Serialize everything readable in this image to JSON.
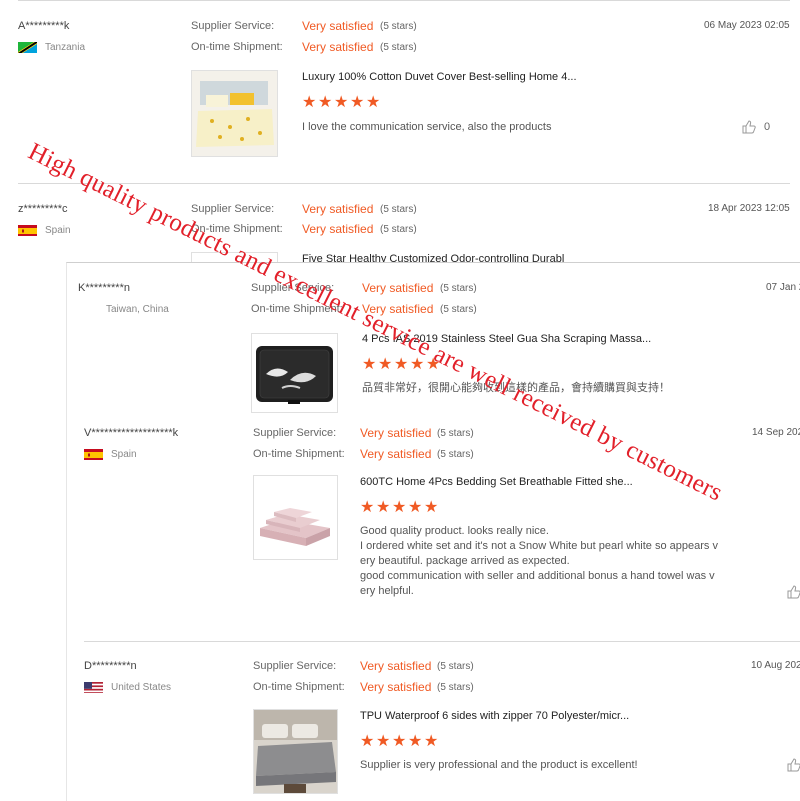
{
  "reviews_back": [
    {
      "name": "A*********k",
      "country": "Tanzania",
      "supplier_label": "Supplier Service:",
      "supplier_value": "Very satisfied",
      "supplier_stars": "(5 stars)",
      "shipment_label": "On-time Shipment:",
      "shipment_value": "Very satisfied",
      "shipment_stars": "(5 stars)",
      "date": "06 May 2023 02:05",
      "product_title": "Luxury 100% Cotton Duvet Cover Best-selling Home 4...",
      "comment": "I love the communication service, also the products",
      "likes": "0"
    },
    {
      "name": "z*********c",
      "country": "Spain",
      "supplier_label": "Supplier Service:",
      "supplier_value": "Very satisfied",
      "supplier_stars": "(5 stars)",
      "shipment_label": "On-time Shipment:",
      "shipment_value": "Very satisfied",
      "shipment_stars": "(5 stars)",
      "date": "18 Apr 2023 12:05",
      "product_title": "Five Star Healthy Customized Odor-controlling Durabl"
    }
  ],
  "reviews_front": [
    {
      "name": "K*********n",
      "country": "Taiwan, China",
      "supplier_label": "Supplier Service:",
      "supplier_value": "Very satisfied",
      "supplier_stars": "(5 stars)",
      "shipment_label": "On-time Shipment:",
      "shipment_value": "Very satisfied",
      "shipment_stars": "(5 stars)",
      "date": "07 Jan 2",
      "product_title": "4 Pcs IAS 2019 Stainless Steel Gua Sha Scraping Massa...",
      "comment_lines": [
        "品質非常好，很開心能夠收到這樣的產品，會持續購買與支持！"
      ]
    },
    {
      "name": "V*******************k",
      "country": "Spain",
      "supplier_label": "Supplier Service:",
      "supplier_value": "Very satisfied",
      "supplier_stars": "(5 stars)",
      "shipment_label": "On-time Shipment:",
      "shipment_value": "Very satisfied",
      "shipment_stars": "(5 stars)",
      "date": "14 Sep 202",
      "product_title": "600TC Home 4Pcs Bedding Set Breathable Fitted she...",
      "comment_lines": [
        "Good quality product. looks really nice.",
        "I ordered white set and it's not a Snow White but pearl white so appears v",
        "ery beautiful. package arrived as expected.",
        "good communication with seller and additional bonus a hand towel was v",
        "ery helpful."
      ]
    },
    {
      "name": "D*********n",
      "country": "United States",
      "supplier_label": "Supplier Service:",
      "supplier_value": "Very satisfied",
      "supplier_stars": "(5 stars)",
      "shipment_label": "On-time Shipment:",
      "shipment_value": "Very satisfied",
      "shipment_stars": "(5 stars)",
      "date": "10 Aug 202",
      "product_title": "TPU Waterproof 6 sides with zipper 70 Polyester/micr...",
      "comment_lines": [
        "Supplier is very professional and the product is excellent!"
      ]
    }
  ],
  "watermark": "High quality products and excellent service are well received by customers",
  "colors": {
    "accent": "#f05a24",
    "watermark": "#e2202a"
  },
  "icons": {
    "star": "star-icon",
    "like": "thumbs-up-icon"
  }
}
